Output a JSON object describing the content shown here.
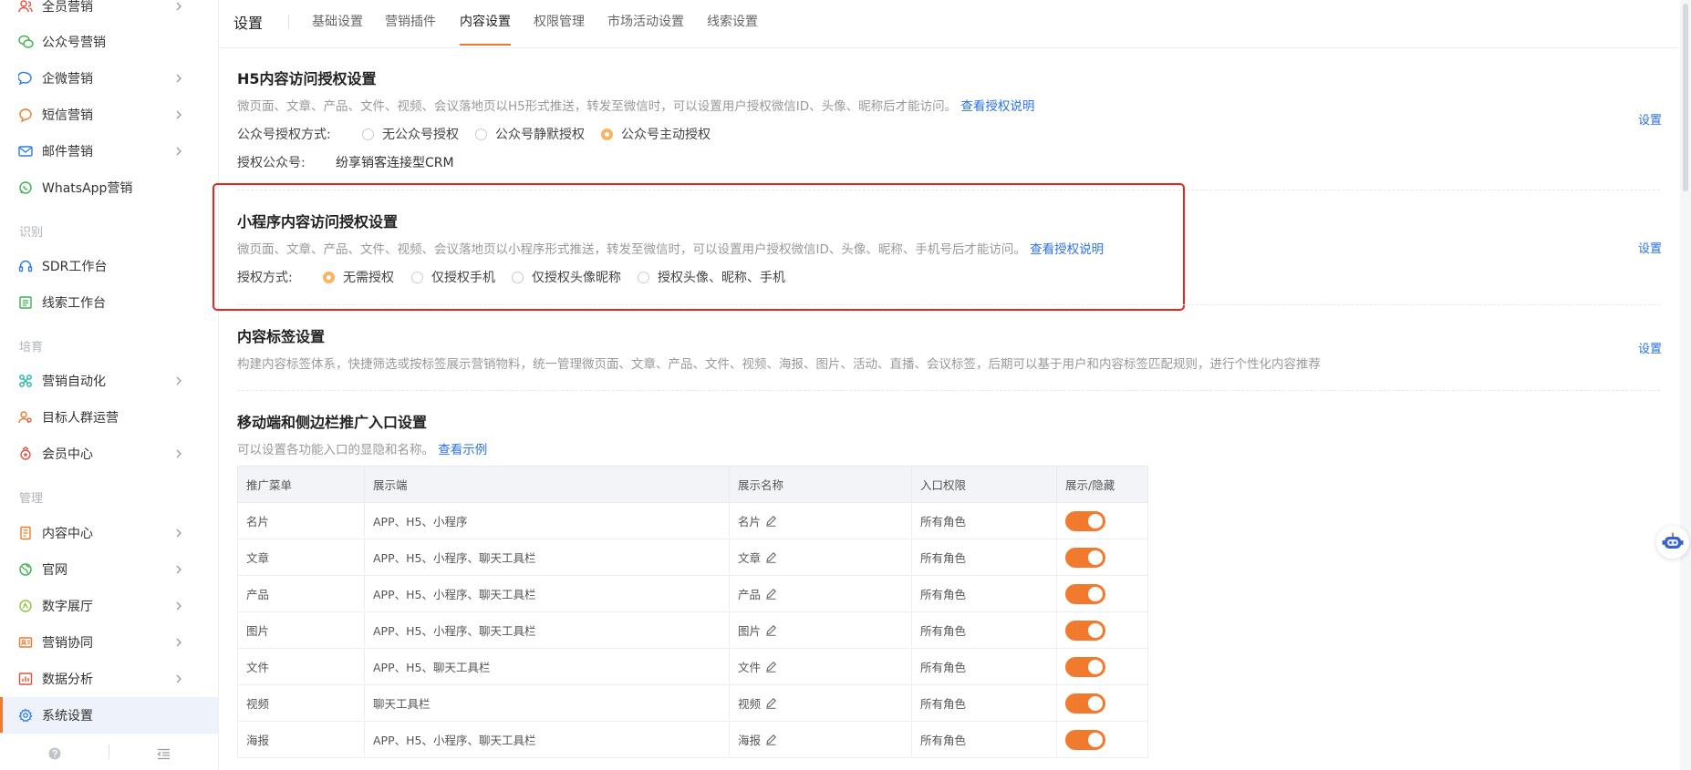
{
  "sidebar": {
    "items": [
      {
        "label": "全员营销",
        "icon": "users-icon",
        "chevron": true
      },
      {
        "label": "公众号营销",
        "icon": "wechat-icon",
        "chevron": false
      },
      {
        "label": "企微营销",
        "icon": "chat-bubble-icon",
        "chevron": true
      },
      {
        "label": "短信营销",
        "icon": "message-icon",
        "chevron": true
      },
      {
        "label": "邮件营销",
        "icon": "mail-icon",
        "chevron": true
      },
      {
        "label": "WhatsApp营销",
        "icon": "whatsapp-icon",
        "chevron": false
      },
      {
        "label": "SDR工作台",
        "icon": "headset-icon",
        "chevron": false
      },
      {
        "label": "线索工作台",
        "icon": "list-icon",
        "chevron": false
      },
      {
        "label": "营销自动化",
        "icon": "automation-icon",
        "chevron": true
      },
      {
        "label": "目标人群运营",
        "icon": "audience-icon",
        "chevron": false
      },
      {
        "label": "会员中心",
        "icon": "member-icon",
        "chevron": true
      },
      {
        "label": "内容中心",
        "icon": "document-icon",
        "chevron": true
      },
      {
        "label": "官网",
        "icon": "globe-icon",
        "chevron": true
      },
      {
        "label": "数字展厅",
        "icon": "showroom-icon",
        "chevron": true
      },
      {
        "label": "营销协同",
        "icon": "collab-icon",
        "chevron": true
      },
      {
        "label": "数据分析",
        "icon": "chart-icon",
        "chevron": true
      },
      {
        "label": "系统设置",
        "icon": "gear-icon",
        "chevron": false
      }
    ],
    "groups": {
      "identify": "识别",
      "cultivate": "培育",
      "manage": "管理"
    }
  },
  "header": {
    "title": "设置",
    "tabs": [
      "基础设置",
      "营销插件",
      "内容设置",
      "权限管理",
      "市场活动设置",
      "线索设置"
    ],
    "active_tab": "内容设置"
  },
  "h5": {
    "title": "H5内容访问授权设置",
    "desc": "微页面、文章、产品、文件、视频、会议落地页以H5形式推送，转发至微信时，可以设置用户授权微信ID、头像、昵称后才能访问。",
    "link": "查看授权说明",
    "set": "设置",
    "auth_label": "公众号授权方式:",
    "options": [
      "无公众号授权",
      "公众号静默授权",
      "公众号主动授权"
    ],
    "selected": "公众号主动授权",
    "account_label": "授权公众号:",
    "account_value": "纷享销客连接型CRM"
  },
  "mini": {
    "title": "小程序内容访问授权设置",
    "desc": "微页面、文章、产品、文件、视频、会议落地页以小程序形式推送，转发至微信时，可以设置用户授权微信ID、头像、昵称、手机号后才能访问。",
    "link": "查看授权说明",
    "set": "设置",
    "auth_label": "授权方式:",
    "options": [
      "无需授权",
      "仅授权手机",
      "仅授权头像昵称",
      "授权头像、昵称、手机"
    ],
    "selected": "无需授权"
  },
  "tags": {
    "title": "内容标签设置",
    "desc": "构建内容标签体系，快捷筛选或按标签展示营销物料，统一管理微页面、文章、产品、文件、视频、海报、图片、活动、直播、会议标签，后期可以基于用户和内容标签匹配规则，进行个性化内容推荐",
    "set": "设置"
  },
  "promo": {
    "title": "移动端和侧边栏推广入口设置",
    "desc": "可以设置各功能入口的显隐和名称。",
    "link": "查看示例",
    "columns": [
      "推广菜单",
      "展示端",
      "展示名称",
      "入口权限",
      "展示/隐藏"
    ],
    "rows": [
      {
        "menu": "名片",
        "terminals": "APP、H5、小程序",
        "name": "名片",
        "permission": "所有角色",
        "visible": true
      },
      {
        "menu": "文章",
        "terminals": "APP、H5、小程序、聊天工具栏",
        "name": "文章",
        "permission": "所有角色",
        "visible": true
      },
      {
        "menu": "产品",
        "terminals": "APP、H5、小程序、聊天工具栏",
        "name": "产品",
        "permission": "所有角色",
        "visible": true
      },
      {
        "menu": "图片",
        "terminals": "APP、H5、小程序、聊天工具栏",
        "name": "图片",
        "permission": "所有角色",
        "visible": true
      },
      {
        "menu": "文件",
        "terminals": "APP、H5、聊天工具栏",
        "name": "文件",
        "permission": "所有角色",
        "visible": true
      },
      {
        "menu": "视频",
        "terminals": "聊天工具栏",
        "name": "视频",
        "permission": "所有角色",
        "visible": true
      },
      {
        "menu": "海报",
        "terminals": "APP、H5、小程序、聊天工具栏",
        "name": "海报",
        "permission": "所有角色",
        "visible": true
      }
    ]
  },
  "colors": {
    "accent": "#f07a2e",
    "link": "#2b72e6",
    "highlight": "#e8251d",
    "radio_on": "#f8b462"
  }
}
